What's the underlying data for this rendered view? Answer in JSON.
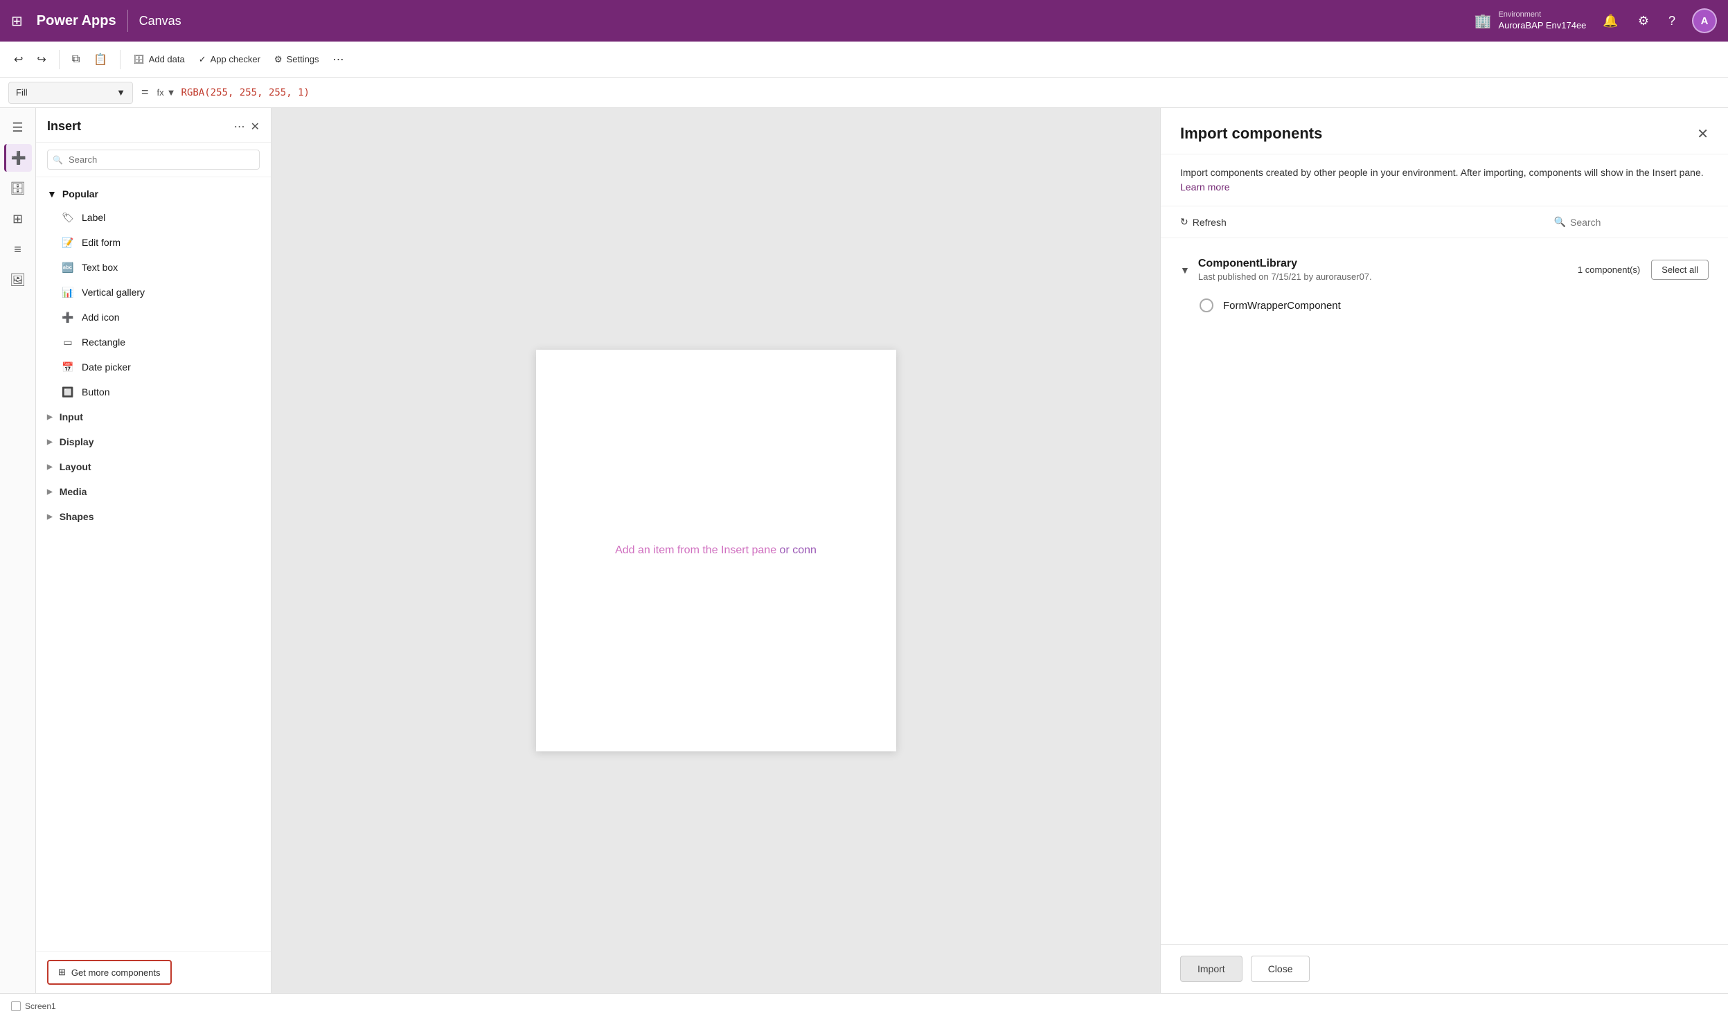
{
  "topbar": {
    "app_name": "Power Apps",
    "divider": "|",
    "canvas_label": "Canvas",
    "env_label": "Environment",
    "env_name": "AuroraBAP Env174ee",
    "avatar_text": "A"
  },
  "toolbar": {
    "undo_label": "Undo",
    "redo_label": "Redo",
    "copy_label": "Copy",
    "add_data_label": "Add data",
    "app_checker_label": "App checker",
    "settings_label": "Settings"
  },
  "formulabar": {
    "fill_label": "Fill",
    "fx_label": "fx",
    "formula": "RGBA(255, 255, 255, 1)"
  },
  "insert_panel": {
    "title": "Insert",
    "search_placeholder": "Search",
    "popular_label": "Popular",
    "items": [
      {
        "label": "Label",
        "icon": "🏷"
      },
      {
        "label": "Edit form",
        "icon": "📝"
      },
      {
        "label": "Text box",
        "icon": "🔤"
      },
      {
        "label": "Vertical gallery",
        "icon": "📊"
      },
      {
        "label": "Add icon",
        "icon": "➕"
      },
      {
        "label": "Rectangle",
        "icon": "▭"
      },
      {
        "label": "Date picker",
        "icon": "📅"
      },
      {
        "label": "Button",
        "icon": "🔲"
      }
    ],
    "categories": [
      {
        "label": "Input"
      },
      {
        "label": "Display"
      },
      {
        "label": "Layout"
      },
      {
        "label": "Media"
      },
      {
        "label": "Shapes"
      }
    ],
    "get_more_label": "Get more components"
  },
  "canvas": {
    "placeholder_text": "Add an item from the Insert pane",
    "link_text": "or conn"
  },
  "bottom_bar": {
    "screen_label": "Screen1"
  },
  "import_panel": {
    "title": "Import components",
    "description": "Import components created by other people in your environment. After importing, components will show in the Insert pane.",
    "learn_more": "Learn more",
    "refresh_label": "Refresh",
    "search_label": "Search",
    "search_placeholder": "Search",
    "library": {
      "name": "ComponentLibrary",
      "meta": "Last published on 7/15/21 by aurorauser07.",
      "count_label": "1 component(s)",
      "select_all_label": "Select all"
    },
    "components": [
      {
        "name": "FormWrapperComponent"
      }
    ],
    "import_label": "Import",
    "close_label": "Close"
  }
}
